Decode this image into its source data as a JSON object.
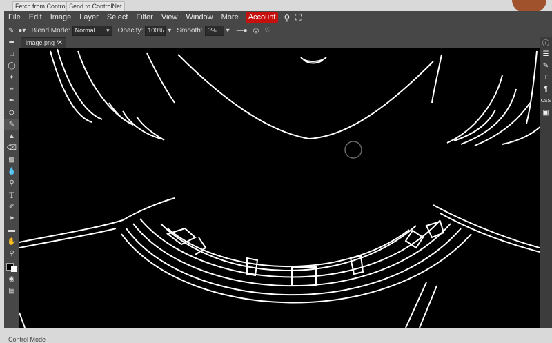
{
  "host": {
    "fetch_button": "Fetch from ControlNet",
    "send_button": "Send to ControlNet",
    "footer_label": "Control Mode"
  },
  "menu": {
    "items": [
      "File",
      "Edit",
      "Image",
      "Layer",
      "Select",
      "Filter",
      "View",
      "Window",
      "More"
    ],
    "account": "Account"
  },
  "options": {
    "blend_mode_label": "Blend Mode:",
    "blend_mode_value": "Normal",
    "opacity_label": "Opacity:",
    "opacity_value": "100%",
    "smooth_label": "Smooth:",
    "smooth_value": "0%"
  },
  "document": {
    "tab_name": "image.png *"
  },
  "right_panel": {
    "css_label": "CSS"
  },
  "colors": {
    "account_bg": "#c5100e",
    "canvas_bg": "#000000",
    "edge_lines": "#ffffff"
  }
}
